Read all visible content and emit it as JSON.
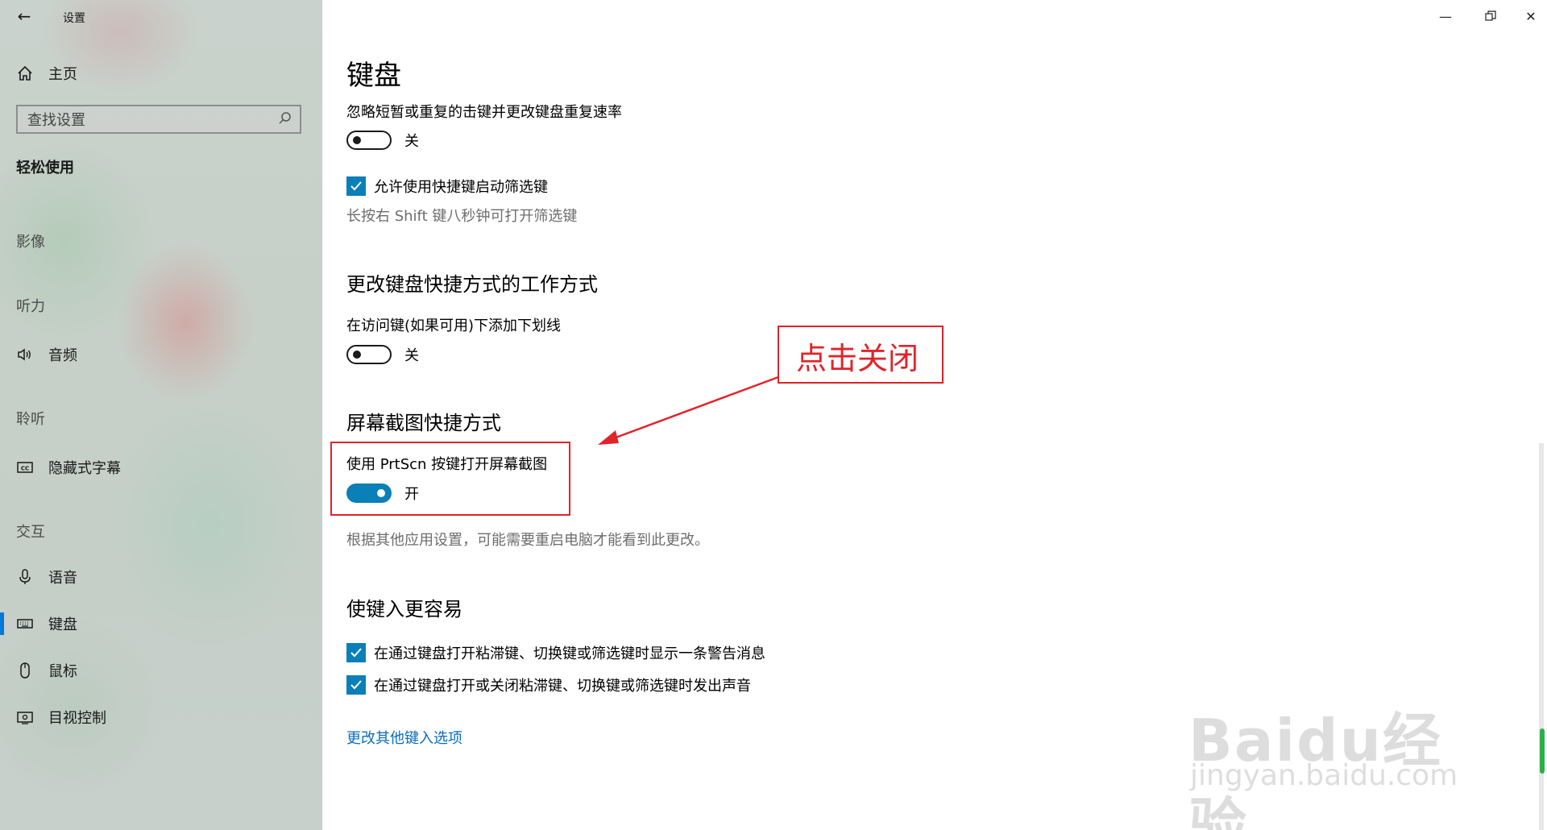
{
  "app": {
    "title": "设置"
  },
  "sidebar": {
    "home_label": "主页",
    "search_placeholder": "查找设置",
    "section_title": "轻松使用",
    "groups": {
      "vision": "影像",
      "hearing": "听力",
      "listening": "聆听",
      "interaction": "交互"
    },
    "items": {
      "audio": "音频",
      "captions": "隐藏式字幕",
      "speech": "语音",
      "keyboard": "键盘",
      "mouse": "鼠标",
      "eye_control": "目视控制"
    },
    "selected": "keyboard"
  },
  "content": {
    "page_title": "键盘",
    "filter_keys": {
      "label": "忽略短暂或重复的击键并更改键盘重复速率",
      "toggle_state": "关",
      "shortcut_check_label": "允许使用快捷键启动筛选键",
      "shortcut_hint": "长按右 Shift 键八秒钟可打开筛选键"
    },
    "shortcuts_section": {
      "heading": "更改键盘快捷方式的工作方式",
      "underline_label": "在访问键(如果可用)下添加下划线",
      "toggle_state": "关"
    },
    "printscreen_section": {
      "heading": "屏幕截图快捷方式",
      "label": "使用 PrtScn 按键打开屏幕截图",
      "toggle_state": "开",
      "note": "根据其他应用设置，可能需要重启电脑才能看到此更改。"
    },
    "typing_section": {
      "heading": "使键入更容易",
      "check1": "在通过键盘打开粘滞键、切换键或筛选键时显示一条警告消息",
      "check2": "在通过键盘打开或关闭粘滞键、切换键或筛选键时发出声音",
      "link": "更改其他键入选项"
    }
  },
  "annotation": {
    "text": "点击关闭"
  },
  "watermark": {
    "logo": "Baidu经验",
    "url": "jingyan.baidu.com"
  },
  "colors": {
    "accent": "#0a7fb8",
    "annotation": "#e0242a",
    "link": "#0a6cbe"
  }
}
